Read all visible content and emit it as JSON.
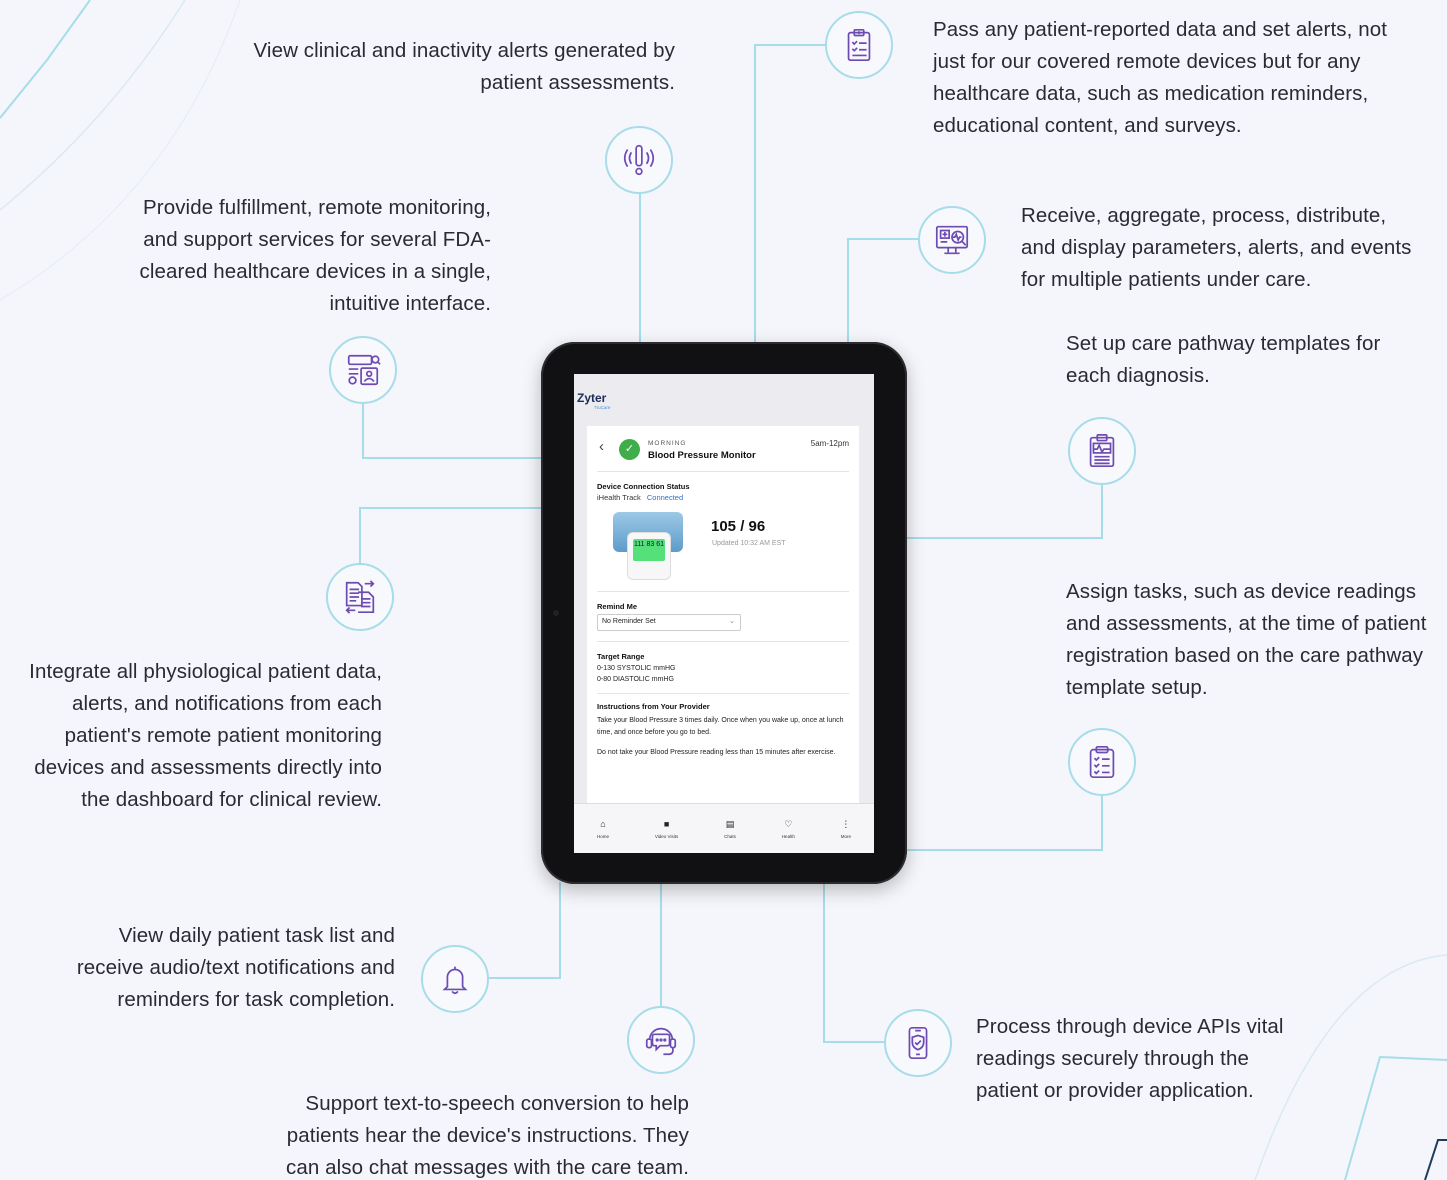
{
  "callouts": {
    "clinical_alerts": "View clinical and inactivity alerts generated by patient assessments.",
    "patient_data": "Pass any patient-reported data and set alerts, not just for our covered remote devices but for any healthcare data, such as medication reminders, educational content, and surveys.",
    "fulfillment": "Provide fulfillment, remote monitoring, and support services for several FDA-cleared healthcare devices in a single, intuitive interface.",
    "aggregate": "Receive, aggregate, process, distribute, and display parameters, alerts, and events for multiple patients under care.",
    "pathway_templates": "Set up care pathway templates for each diagnosis.",
    "integrate": "Integrate all physiological patient data, alerts, and notifications from each patient's remote patient monitoring devices and assessments directly into the dashboard for clinical review.",
    "assign_tasks": "Assign tasks, such as device readings and assessments, at the time of patient registration based on the care pathway template setup.",
    "task_list": "View daily patient task list and receive audio/text notifications and reminders for task completion.",
    "device_apis": "Process through device APIs vital readings securely through the patient or provider application.",
    "tts": "Support text-to-speech conversion to help patients hear the device's instructions. They can also chat messages with the care team."
  },
  "colors": {
    "connector": "#a7dce9",
    "icon_stroke": "#6e4ab3",
    "background": "#f4f6fb"
  },
  "icons": [
    "clipboard-list-icon",
    "alert-signal-icon",
    "monitor-search-icon",
    "profile-search-icon",
    "health-chart-clipboard-icon",
    "documents-transfer-icon",
    "checklist-clipboard-icon",
    "bell-icon",
    "chat-headset-icon",
    "phone-shield-icon"
  ],
  "app": {
    "logo": "Zyter",
    "logo_sub": "TruCare",
    "task": {
      "period": "MORNING",
      "device_name": "Blood Pressure Monitor",
      "window": "5am-12pm"
    },
    "connection": {
      "title": "Device Connection Status",
      "device": "iHealth Track",
      "status": "Connected"
    },
    "reading": {
      "value": "105 / 96",
      "updated": "Updated 10:32 AM EST",
      "lcd": "111 83 61"
    },
    "remind": {
      "title": "Remind Me",
      "value": "No Reminder Set"
    },
    "target": {
      "title": "Target Range",
      "systolic": "0-130 SYSTOLIC mmHG",
      "diastolic": "0-80 DIASTOLIC mmHG"
    },
    "instructions": {
      "title": "Instructions from Your Provider",
      "p1": "Take your Blood Pressure 3 times daily. Once when you wake up, once at lunch time, and once before you go to bed.",
      "p2": "Do not take your Blood Pressure reading less than 15 minutes after exercise."
    },
    "nav": [
      "Home",
      "Video Visits",
      "Chats",
      "Health",
      "More"
    ]
  }
}
